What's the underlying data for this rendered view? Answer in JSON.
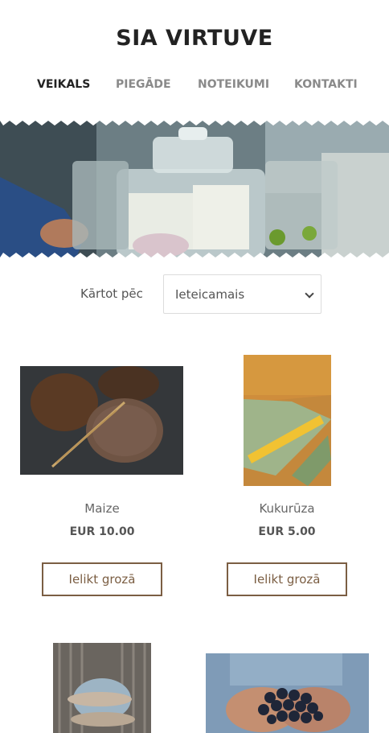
{
  "site": {
    "title": "SIA VIRTUVE"
  },
  "nav": {
    "items": [
      {
        "label": "VEIKALS",
        "active": true
      },
      {
        "label": "PIEGĀDE",
        "active": false
      },
      {
        "label": "NOTEIKUMI",
        "active": false
      },
      {
        "label": "KONTAKTI",
        "active": false
      }
    ]
  },
  "sort": {
    "label": "Kārtot pēc",
    "selected": "Ieteicamais"
  },
  "products": [
    {
      "name": "Maize",
      "price": "EUR 10.00",
      "button": "Ielikt grozā",
      "image": "bread-image"
    },
    {
      "name": "Kukurūza",
      "price": "EUR 5.00",
      "button": "Ielikt grozā",
      "image": "corn-image"
    },
    {
      "image": "fish-image"
    },
    {
      "image": "blueberries-image"
    }
  ],
  "colors": {
    "accent": "#7b5e43",
    "text_dark": "#222222",
    "nav_inactive": "#8a8a8a"
  }
}
